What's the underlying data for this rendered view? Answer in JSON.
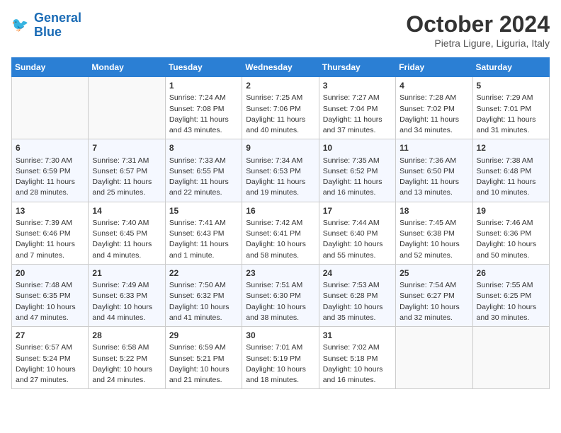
{
  "header": {
    "logo_line1": "General",
    "logo_line2": "Blue",
    "month": "October 2024",
    "location": "Pietra Ligure, Liguria, Italy"
  },
  "days_of_week": [
    "Sunday",
    "Monday",
    "Tuesday",
    "Wednesday",
    "Thursday",
    "Friday",
    "Saturday"
  ],
  "weeks": [
    [
      {
        "day": "",
        "sunrise": "",
        "sunset": "",
        "daylight": ""
      },
      {
        "day": "",
        "sunrise": "",
        "sunset": "",
        "daylight": ""
      },
      {
        "day": "1",
        "sunrise": "Sunrise: 7:24 AM",
        "sunset": "Sunset: 7:08 PM",
        "daylight": "Daylight: 11 hours and 43 minutes."
      },
      {
        "day": "2",
        "sunrise": "Sunrise: 7:25 AM",
        "sunset": "Sunset: 7:06 PM",
        "daylight": "Daylight: 11 hours and 40 minutes."
      },
      {
        "day": "3",
        "sunrise": "Sunrise: 7:27 AM",
        "sunset": "Sunset: 7:04 PM",
        "daylight": "Daylight: 11 hours and 37 minutes."
      },
      {
        "day": "4",
        "sunrise": "Sunrise: 7:28 AM",
        "sunset": "Sunset: 7:02 PM",
        "daylight": "Daylight: 11 hours and 34 minutes."
      },
      {
        "day": "5",
        "sunrise": "Sunrise: 7:29 AM",
        "sunset": "Sunset: 7:01 PM",
        "daylight": "Daylight: 11 hours and 31 minutes."
      }
    ],
    [
      {
        "day": "6",
        "sunrise": "Sunrise: 7:30 AM",
        "sunset": "Sunset: 6:59 PM",
        "daylight": "Daylight: 11 hours and 28 minutes."
      },
      {
        "day": "7",
        "sunrise": "Sunrise: 7:31 AM",
        "sunset": "Sunset: 6:57 PM",
        "daylight": "Daylight: 11 hours and 25 minutes."
      },
      {
        "day": "8",
        "sunrise": "Sunrise: 7:33 AM",
        "sunset": "Sunset: 6:55 PM",
        "daylight": "Daylight: 11 hours and 22 minutes."
      },
      {
        "day": "9",
        "sunrise": "Sunrise: 7:34 AM",
        "sunset": "Sunset: 6:53 PM",
        "daylight": "Daylight: 11 hours and 19 minutes."
      },
      {
        "day": "10",
        "sunrise": "Sunrise: 7:35 AM",
        "sunset": "Sunset: 6:52 PM",
        "daylight": "Daylight: 11 hours and 16 minutes."
      },
      {
        "day": "11",
        "sunrise": "Sunrise: 7:36 AM",
        "sunset": "Sunset: 6:50 PM",
        "daylight": "Daylight: 11 hours and 13 minutes."
      },
      {
        "day": "12",
        "sunrise": "Sunrise: 7:38 AM",
        "sunset": "Sunset: 6:48 PM",
        "daylight": "Daylight: 11 hours and 10 minutes."
      }
    ],
    [
      {
        "day": "13",
        "sunrise": "Sunrise: 7:39 AM",
        "sunset": "Sunset: 6:46 PM",
        "daylight": "Daylight: 11 hours and 7 minutes."
      },
      {
        "day": "14",
        "sunrise": "Sunrise: 7:40 AM",
        "sunset": "Sunset: 6:45 PM",
        "daylight": "Daylight: 11 hours and 4 minutes."
      },
      {
        "day": "15",
        "sunrise": "Sunrise: 7:41 AM",
        "sunset": "Sunset: 6:43 PM",
        "daylight": "Daylight: 11 hours and 1 minute."
      },
      {
        "day": "16",
        "sunrise": "Sunrise: 7:42 AM",
        "sunset": "Sunset: 6:41 PM",
        "daylight": "Daylight: 10 hours and 58 minutes."
      },
      {
        "day": "17",
        "sunrise": "Sunrise: 7:44 AM",
        "sunset": "Sunset: 6:40 PM",
        "daylight": "Daylight: 10 hours and 55 minutes."
      },
      {
        "day": "18",
        "sunrise": "Sunrise: 7:45 AM",
        "sunset": "Sunset: 6:38 PM",
        "daylight": "Daylight: 10 hours and 52 minutes."
      },
      {
        "day": "19",
        "sunrise": "Sunrise: 7:46 AM",
        "sunset": "Sunset: 6:36 PM",
        "daylight": "Daylight: 10 hours and 50 minutes."
      }
    ],
    [
      {
        "day": "20",
        "sunrise": "Sunrise: 7:48 AM",
        "sunset": "Sunset: 6:35 PM",
        "daylight": "Daylight: 10 hours and 47 minutes."
      },
      {
        "day": "21",
        "sunrise": "Sunrise: 7:49 AM",
        "sunset": "Sunset: 6:33 PM",
        "daylight": "Daylight: 10 hours and 44 minutes."
      },
      {
        "day": "22",
        "sunrise": "Sunrise: 7:50 AM",
        "sunset": "Sunset: 6:32 PM",
        "daylight": "Daylight: 10 hours and 41 minutes."
      },
      {
        "day": "23",
        "sunrise": "Sunrise: 7:51 AM",
        "sunset": "Sunset: 6:30 PM",
        "daylight": "Daylight: 10 hours and 38 minutes."
      },
      {
        "day": "24",
        "sunrise": "Sunrise: 7:53 AM",
        "sunset": "Sunset: 6:28 PM",
        "daylight": "Daylight: 10 hours and 35 minutes."
      },
      {
        "day": "25",
        "sunrise": "Sunrise: 7:54 AM",
        "sunset": "Sunset: 6:27 PM",
        "daylight": "Daylight: 10 hours and 32 minutes."
      },
      {
        "day": "26",
        "sunrise": "Sunrise: 7:55 AM",
        "sunset": "Sunset: 6:25 PM",
        "daylight": "Daylight: 10 hours and 30 minutes."
      }
    ],
    [
      {
        "day": "27",
        "sunrise": "Sunrise: 6:57 AM",
        "sunset": "Sunset: 5:24 PM",
        "daylight": "Daylight: 10 hours and 27 minutes."
      },
      {
        "day": "28",
        "sunrise": "Sunrise: 6:58 AM",
        "sunset": "Sunset: 5:22 PM",
        "daylight": "Daylight: 10 hours and 24 minutes."
      },
      {
        "day": "29",
        "sunrise": "Sunrise: 6:59 AM",
        "sunset": "Sunset: 5:21 PM",
        "daylight": "Daylight: 10 hours and 21 minutes."
      },
      {
        "day": "30",
        "sunrise": "Sunrise: 7:01 AM",
        "sunset": "Sunset: 5:19 PM",
        "daylight": "Daylight: 10 hours and 18 minutes."
      },
      {
        "day": "31",
        "sunrise": "Sunrise: 7:02 AM",
        "sunset": "Sunset: 5:18 PM",
        "daylight": "Daylight: 10 hours and 16 minutes."
      },
      {
        "day": "",
        "sunrise": "",
        "sunset": "",
        "daylight": ""
      },
      {
        "day": "",
        "sunrise": "",
        "sunset": "",
        "daylight": ""
      }
    ]
  ]
}
